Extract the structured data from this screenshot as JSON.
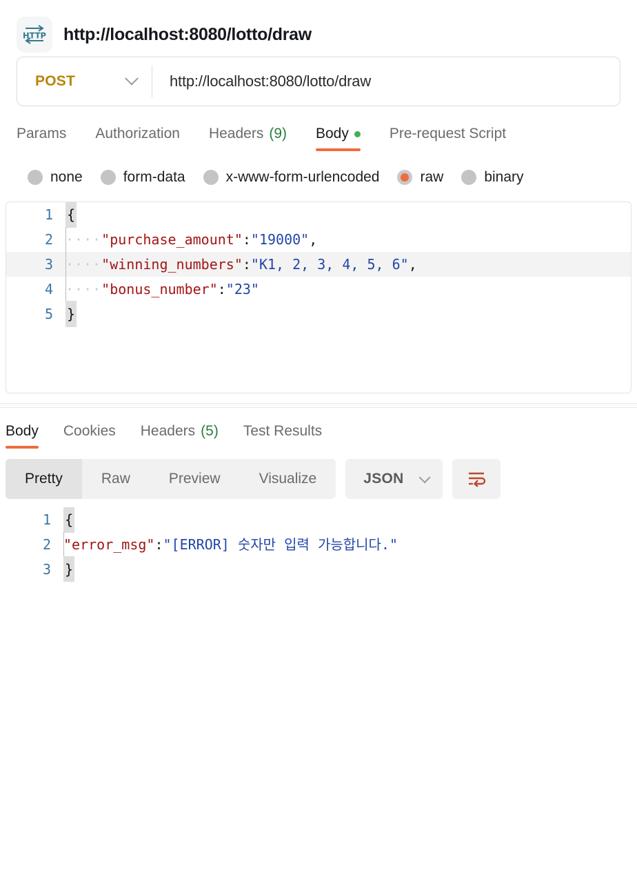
{
  "header": {
    "icon": "http-icon",
    "icon_text": "HTTP",
    "title": "http://localhost:8080/lotto/draw"
  },
  "url_bar": {
    "method": "POST",
    "method_color": "#b8860b",
    "dropdown_icon": "chevron-down-icon",
    "url": "http://localhost:8080/lotto/draw"
  },
  "request_tabs": [
    {
      "label": "Params",
      "active": false
    },
    {
      "label": "Authorization",
      "active": false
    },
    {
      "label": "Headers",
      "count": "(9)",
      "active": false
    },
    {
      "label": "Body",
      "active": true,
      "dot": true
    },
    {
      "label": "Pre-request Script",
      "active": false
    }
  ],
  "body_types": [
    {
      "label": "none",
      "selected": false
    },
    {
      "label": "form-data",
      "selected": false
    },
    {
      "label": "x-www-form-urlencoded",
      "selected": false
    },
    {
      "label": "raw",
      "selected": true
    },
    {
      "label": "binary",
      "selected": false
    }
  ],
  "request_body": {
    "lines": [
      {
        "n": "1",
        "open_brace": "{"
      },
      {
        "n": "2",
        "indent": "····",
        "key": "\"purchase_amount\"",
        "colon": ":",
        "space": " ",
        "value": "\"19000\"",
        "tail": ","
      },
      {
        "n": "3",
        "indent": "····",
        "key": "\"winning_numbers\"",
        "colon": ":",
        "space": " ",
        "value": "\"K1, 2, 3, 4, 5, 6\"",
        "tail": ",",
        "highlight": true
      },
      {
        "n": "4",
        "indent": "····",
        "key": "\"bonus_number\"",
        "colon": ":",
        "space": " ",
        "value": "\"23\"",
        "tail": ""
      },
      {
        "n": "5",
        "close_brace": "}"
      }
    ]
  },
  "response_tabs": [
    {
      "label": "Body",
      "active": true
    },
    {
      "label": "Cookies",
      "active": false
    },
    {
      "label": "Headers",
      "count": "(5)",
      "active": false
    },
    {
      "label": "Test Results",
      "active": false
    }
  ],
  "response_toolbar": {
    "views": [
      {
        "label": "Pretty",
        "active": true
      },
      {
        "label": "Raw",
        "active": false
      },
      {
        "label": "Preview",
        "active": false
      },
      {
        "label": "Visualize",
        "active": false
      }
    ],
    "format": "JSON",
    "format_dropdown_icon": "chevron-down-icon",
    "wrap_icon": "word-wrap-icon",
    "wrap_icon_color": "#c0462a"
  },
  "response_body": {
    "lines": [
      {
        "n": "1",
        "open_brace": "{"
      },
      {
        "n": "2",
        "indent": "    ",
        "key": "\"error_msg\"",
        "colon": ":",
        "space": "  ",
        "value": "\"[ERROR] 숫자만 입력 가능합니다.\"",
        "tail": ""
      },
      {
        "n": "3",
        "close_brace": "}"
      }
    ]
  },
  "colors": {
    "accent": "#ef6c3e",
    "method": "#b8860b",
    "count": "#2a7d3f",
    "key": "#a31515",
    "value": "#2346a8",
    "line_number": "#3b76a5"
  }
}
